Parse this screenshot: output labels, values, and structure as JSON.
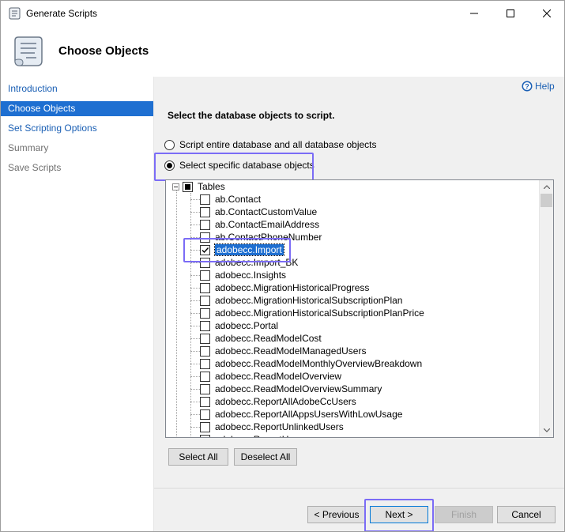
{
  "window": {
    "title": "Generate Scripts"
  },
  "header": {
    "title": "Choose Objects"
  },
  "nav": [
    {
      "label": "Introduction",
      "state": "link"
    },
    {
      "label": "Choose Objects",
      "state": "selected"
    },
    {
      "label": "Set Scripting Options",
      "state": "link"
    },
    {
      "label": "Summary",
      "state": "disabled"
    },
    {
      "label": "Save Scripts",
      "state": "disabled"
    }
  ],
  "help": {
    "label": "Help",
    "icon": "help-icon"
  },
  "instruction": "Select the database objects to script.",
  "options": {
    "entire_db": "Script entire database and all database objects",
    "specific": "Select specific database objects",
    "selected": "specific"
  },
  "tree": {
    "root": "Tables",
    "root_state": "partial",
    "items": [
      {
        "label": "ab.Contact",
        "checked": false
      },
      {
        "label": "ab.ContactCustomValue",
        "checked": false
      },
      {
        "label": "ab.ContactEmailAddress",
        "checked": false
      },
      {
        "label": "ab.ContactPhoneNumber",
        "checked": false
      },
      {
        "label": "adobecc.Import",
        "checked": true
      },
      {
        "label": "adobecc.Import_BK",
        "checked": false
      },
      {
        "label": "adobecc.Insights",
        "checked": false
      },
      {
        "label": "adobecc.MigrationHistoricalProgress",
        "checked": false
      },
      {
        "label": "adobecc.MigrationHistoricalSubscriptionPlan",
        "checked": false
      },
      {
        "label": "adobecc.MigrationHistoricalSubscriptionPlanPrice",
        "checked": false
      },
      {
        "label": "adobecc.Portal",
        "checked": false
      },
      {
        "label": "adobecc.ReadModelCost",
        "checked": false
      },
      {
        "label": "adobecc.ReadModelManagedUsers",
        "checked": false
      },
      {
        "label": "adobecc.ReadModelMonthlyOverviewBreakdown",
        "checked": false
      },
      {
        "label": "adobecc.ReadModelOverview",
        "checked": false
      },
      {
        "label": "adobecc.ReadModelOverviewSummary",
        "checked": false
      },
      {
        "label": "adobecc.ReportAllAdobeCcUsers",
        "checked": false
      },
      {
        "label": "adobecc.ReportAllAppsUsersWithLowUsage",
        "checked": false
      },
      {
        "label": "adobecc.ReportUnlinkedUsers",
        "checked": false
      },
      {
        "label": "adobecc.ReportUsers",
        "checked": false
      }
    ]
  },
  "buttons": {
    "select_all": "Select All",
    "deselect_all": "Deselect All",
    "previous": "< Previous",
    "next": "Next >",
    "finish": "Finish",
    "cancel": "Cancel"
  },
  "colors": {
    "selection": "#1e6fd1",
    "highlight_annotation": "#7b6cf6",
    "link": "#1a5fb4"
  }
}
